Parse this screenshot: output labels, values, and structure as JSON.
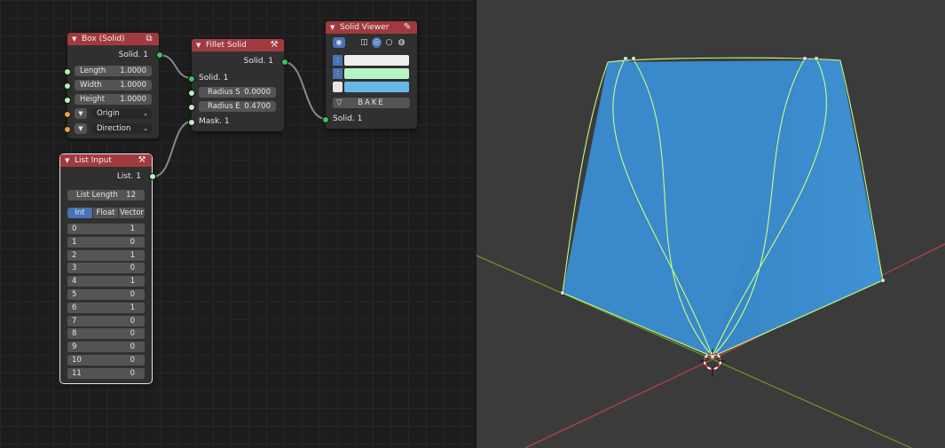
{
  "nodes": {
    "box": {
      "title": "Box (Solid)",
      "output": "Solid. 1",
      "fields": [
        {
          "label": "Length",
          "value": "1.0000"
        },
        {
          "label": "Width",
          "value": "1.0000"
        },
        {
          "label": "Height",
          "value": "1.0000"
        }
      ],
      "origin_label": "Origin",
      "direction_label": "Direction"
    },
    "fillet": {
      "title": "Fillet Solid",
      "output": "Solid. 1",
      "input_solid": "Solid. 1",
      "radius_s_label": "Radius S",
      "radius_s_value": "0.0000",
      "radius_e_label": "Radius E",
      "radius_e_value": "0.4700",
      "input_mask": "Mask. 1"
    },
    "viewer": {
      "title": "Solid Viewer",
      "bake_label": "BAKE",
      "input_solid": "Solid. 1",
      "colors": [
        "#eeeeee",
        "#b8f5c4",
        "#67b8e8"
      ]
    },
    "list": {
      "title": "List Input",
      "output": "List. 1",
      "length_label": "List Length",
      "length_value": "12",
      "modes": [
        "Int",
        "Float",
        "Vector"
      ],
      "active_mode": "Int",
      "items": [
        {
          "index": "0",
          "value": "1"
        },
        {
          "index": "1",
          "value": "0"
        },
        {
          "index": "2",
          "value": "1"
        },
        {
          "index": "3",
          "value": "0"
        },
        {
          "index": "4",
          "value": "1"
        },
        {
          "index": "5",
          "value": "0"
        },
        {
          "index": "6",
          "value": "1"
        },
        {
          "index": "7",
          "value": "0"
        },
        {
          "index": "8",
          "value": "0"
        },
        {
          "index": "9",
          "value": "0"
        },
        {
          "index": "10",
          "value": "0"
        },
        {
          "index": "11",
          "value": "0"
        }
      ]
    }
  },
  "colors": {
    "node_header": "#a13a3e",
    "mesh_face": "#3d8fd1",
    "mesh_edge": "#c8ff7a",
    "axis_x": "#b5414a",
    "axis_y": "#6f8f2a",
    "active_mode": "#4772b3"
  },
  "icons": {
    "box_header": "cube-icon",
    "fillet_header": "fillet-tool-icon",
    "viewer_header": "pen-icon",
    "list_header": "list-tool-icon",
    "viewer_eye": "eye-icon",
    "bake": "triangle-down-icon"
  }
}
